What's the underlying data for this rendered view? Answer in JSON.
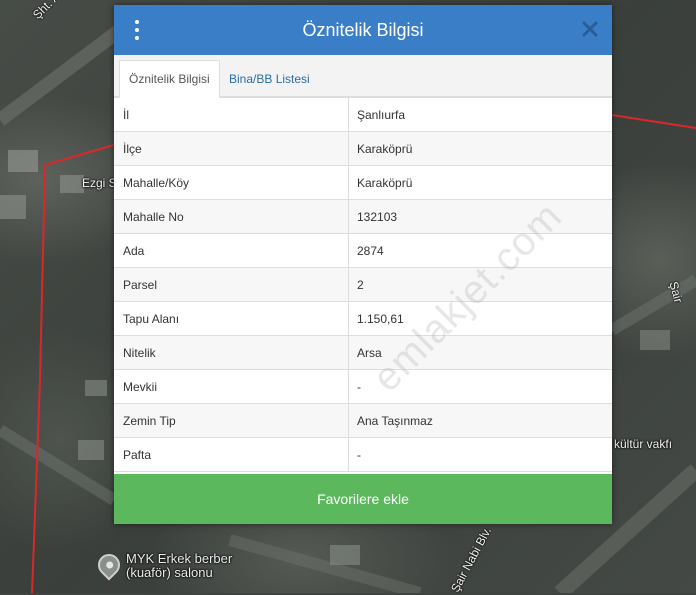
{
  "map": {
    "labels": {
      "street_top_left": "Şht. Abdulselam",
      "street_left": "Ezgi S",
      "street_right": "Şair",
      "place_right": "n kültür vakfı",
      "street_bottom": "Şair Nabi Blv."
    },
    "poi": {
      "line1": "MYK Erkek berber",
      "line2": "(kuaför) salonu",
      "icon": "map-pin-icon"
    },
    "parcel_outline_color": "#d9282a"
  },
  "dialog": {
    "title": "Öznitelik Bilgisi",
    "header_color": "#3b7ec8",
    "tabs": [
      {
        "label": "Öznitelik Bilgisi",
        "active": true
      },
      {
        "label": "Bina/BB Listesi",
        "active": false
      }
    ],
    "rows": [
      {
        "key": "İl",
        "value": "Şanlıurfa"
      },
      {
        "key": "İlçe",
        "value": "Karaköprü"
      },
      {
        "key": "Mahalle/Köy",
        "value": "Karaköprü"
      },
      {
        "key": "Mahalle No",
        "value": "132103"
      },
      {
        "key": "Ada",
        "value": "2874"
      },
      {
        "key": "Parsel",
        "value": "2"
      },
      {
        "key": "Tapu Alanı",
        "value": "1.150,61"
      },
      {
        "key": "Nitelik",
        "value": "Arsa"
      },
      {
        "key": "Mevkii",
        "value": "-"
      },
      {
        "key": "Zemin Tip",
        "value": "Ana Taşınmaz"
      },
      {
        "key": "Pafta",
        "value": "-"
      }
    ],
    "favorite_button": "Favorilere ekle",
    "favorite_color": "#5cb85c",
    "watermark": "emlakjet.com"
  }
}
